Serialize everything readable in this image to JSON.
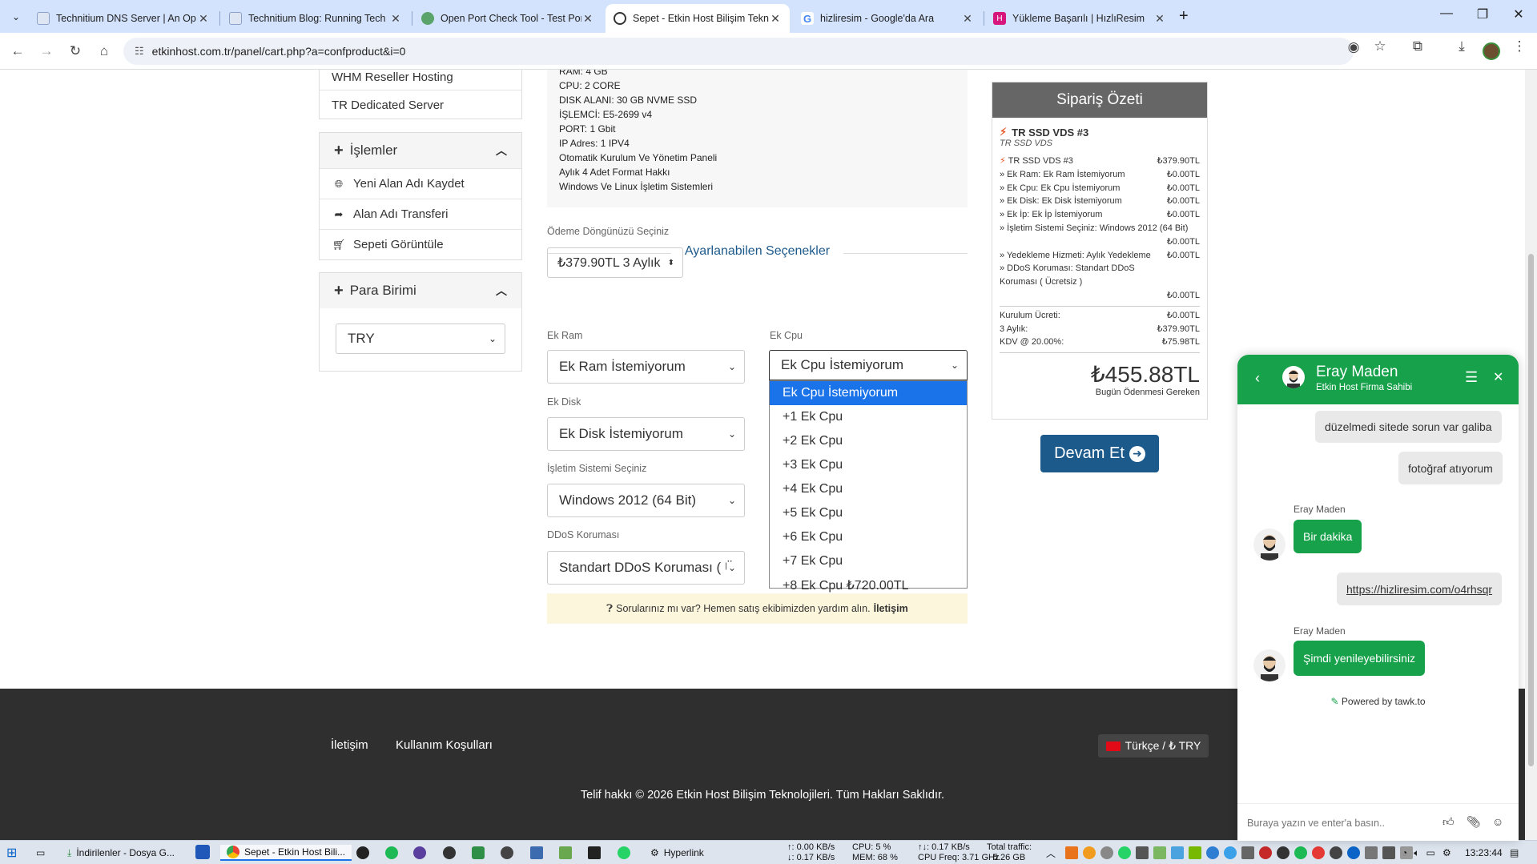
{
  "browser": {
    "tabs": [
      {
        "title": "Technitium DNS Server | An Op",
        "active": false
      },
      {
        "title": "Technitium Blog: Running Tech",
        "active": false
      },
      {
        "title": "Open Port Check Tool - Test Por",
        "active": false
      },
      {
        "title": "Sepet - Etkin Host Bilişim Tekno",
        "active": true
      },
      {
        "title": "hizliresim - Google'da Ara",
        "active": false
      },
      {
        "title": "Yükleme Başarılı | HızlıResim",
        "active": false
      }
    ],
    "url": "etkinhost.com.tr/panel/cart.php?a=confproduct&i=0"
  },
  "sidebar": {
    "products": [
      "WHM Reseller Hosting",
      "TR Dedicated Server"
    ],
    "actions_title": "İşlemler",
    "actions": [
      {
        "label": "Yeni Alan Adı Kaydet",
        "icon": "globe-icon"
      },
      {
        "label": "Alan Adı Transferi",
        "icon": "share-icon"
      },
      {
        "label": "Sepeti Görüntüle",
        "icon": "cart-icon"
      }
    ],
    "currency_title": "Para Birimi",
    "currency_value": "TRY"
  },
  "specs": {
    "partial_top": "RAM: 4 GB",
    "lines": [
      "CPU: 2 CORE",
      "DISK ALANI: 30 GB NVME SSD",
      "İŞLEMCİ: E5-2699 v4",
      "PORT: 1 Gbit",
      "IP Adres: 1 IPV4",
      "Otomatik Kurulum Ve Yönetim Paneli",
      "Aylık 4 Adet Format Hakkı",
      "Windows Ve Linux İşletim Sistemleri"
    ]
  },
  "billing": {
    "label": "Ödeme Döngünüzü Seçiniz",
    "value": "₺379.90TL 3 Aylık"
  },
  "options": {
    "section_title": "Ayarlanabilen Seçenekler",
    "ek_ram_label": "Ek Ram",
    "ek_ram_value": "Ek Ram İstemiyorum",
    "ek_cpu_label": "Ek Cpu",
    "ek_cpu_value": "Ek Cpu İstemiyorum",
    "ek_disk_label": "Ek Disk",
    "ek_disk_value": "Ek Disk İstemiyorum",
    "os_label": "İşletim Sistemi Seçiniz",
    "os_value": "Windows 2012 (64 Bit)",
    "ddos_label": "DDoS Koruması",
    "ddos_value": "Standart DDoS Koruması ( Ü",
    "cpu_dropdown": [
      "Ek Cpu İstemiyorum",
      "+1 Ek Cpu",
      "+2 Ek Cpu",
      "+3 Ek Cpu",
      "+4 Ek Cpu",
      "+5 Ek Cpu",
      "+6 Ek Cpu",
      "+7 Ek Cpu",
      "+8 Ek Cpu ₺720.00TL"
    ]
  },
  "infobar": {
    "text": "Sorularınız mı var? Hemen satış ekibimizden yardım alın.",
    "link": "İletişim"
  },
  "summary": {
    "title": "Sipariş Özeti",
    "product": "TR SSD VDS #3",
    "group": "TR SSD VDS",
    "lines": [
      {
        "label": "TR SSD VDS #3",
        "value": "₺379.90TL",
        "bolt": true
      },
      {
        "label": "» Ek Ram: Ek Ram İstemiyorum",
        "value": "₺0.00TL"
      },
      {
        "label": "» Ek Cpu: Ek Cpu İstemiyorum",
        "value": "₺0.00TL"
      },
      {
        "label": "» Ek Disk: Ek Disk İstemiyorum",
        "value": "₺0.00TL"
      },
      {
        "label": "» Ek İp: Ek İp İstemiyorum",
        "value": "₺0.00TL"
      }
    ],
    "os_line": "» İşletim Sistemi Seçiniz: Windows 2012 (64 Bit)",
    "os_value": "₺0.00TL",
    "backup_line": "» Yedekleme Hizmeti: Aylık Yedekleme",
    "backup_value": "₺0.00TL",
    "ddos_line": "» DDoS Koruması: Standart DDoS Koruması ( Ücretsiz )",
    "ddos_value": "₺0.00TL",
    "setup_label": "Kurulum Ücreti:",
    "setup_value": "₺0.00TL",
    "period_label": "3 Aylık:",
    "period_value": "₺379.90TL",
    "tax_label": "KDV @ 20.00%:",
    "tax_value": "₺75.98TL",
    "total": "₺455.88TL",
    "total_caption": "Bugün Ödenmesi Gereken",
    "continue": "Devam Et"
  },
  "footer": {
    "links": [
      "İletişim",
      "Kullanım Koşulları"
    ],
    "language": "Türkçe / ₺ TRY",
    "copyright": "Telif hakkı © 2026 Etkin Host Bilişim Teknolojileri. Tüm Hakları Saklıdır."
  },
  "chat": {
    "agent_name": "Eray Maden",
    "agent_title": "Etkin Host Firma Sahibi",
    "messages": [
      {
        "from": "user",
        "text": "düzelmedi sitede sorun var galiba"
      },
      {
        "from": "user",
        "text": "fotoğraf atıyorum"
      },
      {
        "from": "agent",
        "name": "Eray Maden",
        "text": "Bir dakika"
      },
      {
        "from": "user",
        "text": "https://hizliresim.com/o4rhsqr"
      },
      {
        "from": "agent",
        "name": "Eray Maden",
        "text": "Şimdi yenileyebilirsiniz"
      }
    ],
    "powered": "Powered by tawk.to",
    "placeholder": "Buraya yazın ve enter'a basın.."
  },
  "taskbar": {
    "items": [
      "İndirilenler - Dosya G...",
      "Sepet - Etkin Host Bili...",
      "Hyperlink"
    ],
    "net_up": "↑: 0.00 KB/s",
    "net_down": "↓: 0.17 KB/s",
    "cpu": "CPU: 5 %",
    "mem": "MEM: 68 %",
    "io_up": "↑↓: 0.17 KB/s",
    "cpu_freq": "CPU Freq: 3.71 GHz",
    "traffic_label": "Total traffic:",
    "traffic_value": "5.26 GB",
    "time": "13:23:44"
  }
}
